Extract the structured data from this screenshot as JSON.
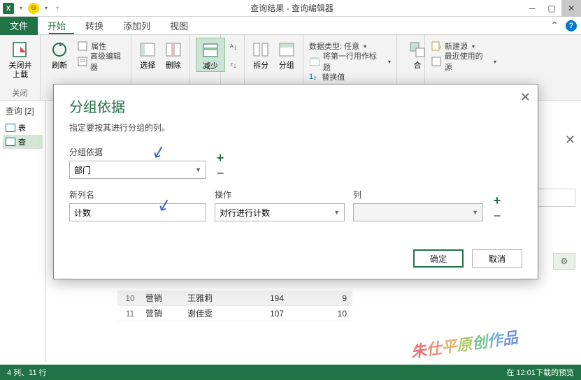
{
  "titlebar": {
    "title": "查询结果 - 查询编辑器"
  },
  "tabs": {
    "file": "文件",
    "items": [
      "开始",
      "转换",
      "添加列",
      "视图"
    ]
  },
  "ribbon": {
    "close": {
      "label": "关闭并\n上载",
      "group": "关闭"
    },
    "refresh": "刷新",
    "properties": "属性",
    "advanced": "高级编辑器",
    "select": "选择",
    "delete": "删除",
    "reduce": "减少",
    "split": "拆分",
    "group": "分组",
    "datatype": "数据类型: 任意",
    "firstrow": "将第一行用作标题",
    "replace": "替换值",
    "combine": "合",
    "newsource": "新建源",
    "recent": "最近使用的源"
  },
  "sidebar": {
    "title": "查询 [2]",
    "items": [
      "表",
      "查"
    ]
  },
  "table": {
    "rows": [
      {
        "n": "10",
        "dept": "营销",
        "name": "王雅莉",
        "v1": "194",
        "v2": "9"
      },
      {
        "n": "11",
        "dept": "营销",
        "name": "谢佳雯",
        "v1": "107",
        "v2": "10"
      }
    ]
  },
  "dialog": {
    "title": "分组依据",
    "desc": "指定要按其进行分组的列。",
    "groupby_label": "分组依据",
    "groupby_value": "部门",
    "newcol_label": "新列名",
    "newcol_value": "计数",
    "op_label": "操作",
    "op_value": "对行进行计数",
    "col_label": "列",
    "ok": "确定",
    "cancel": "取消"
  },
  "status": {
    "left": "4 列、11 行",
    "right": "在 12:01下载的预览"
  },
  "watermark": "朱仕平原创作品"
}
